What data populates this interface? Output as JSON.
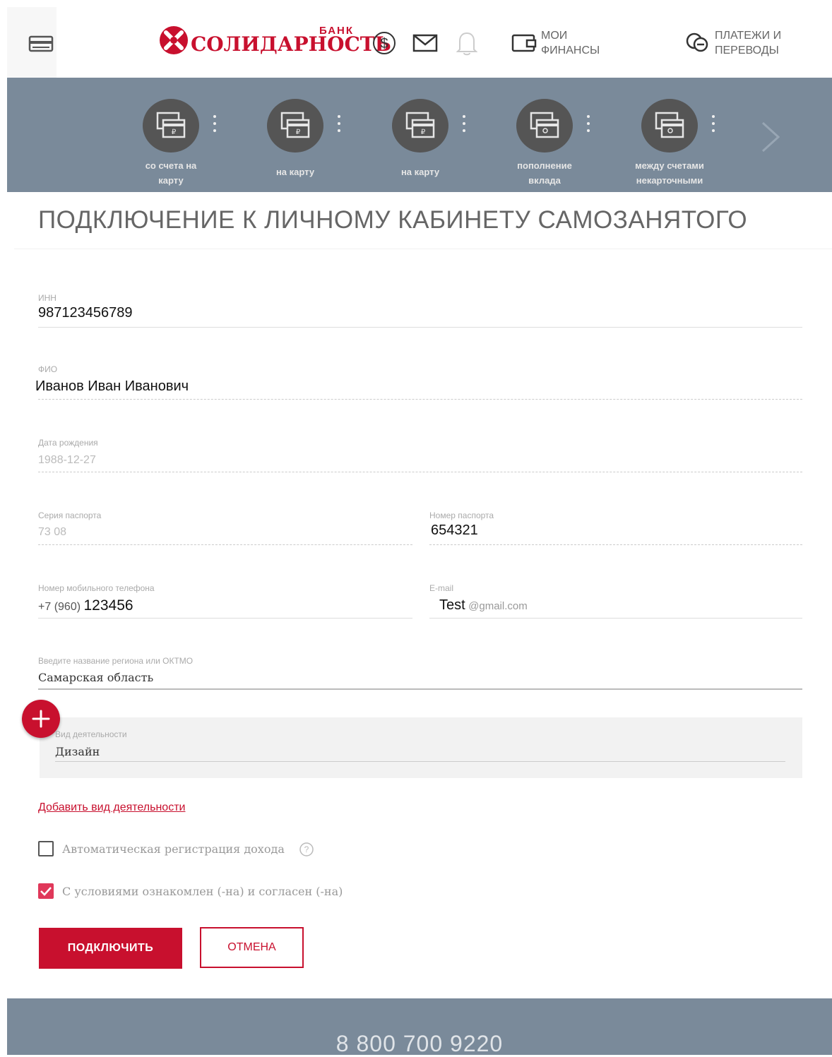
{
  "header": {
    "logo_bank": "БАНК",
    "logo_name": "СОЛИДАРНОСТЬ",
    "menu_finances": [
      "МОИ",
      "ФИНАНСЫ"
    ],
    "menu_payments": [
      "ПЛАТЕЖИ И",
      "ПЕРЕВОДЫ"
    ]
  },
  "carousel": {
    "items": [
      {
        "label": [
          "со счета на",
          "карту"
        ],
        "icon": "card-ruble-icon"
      },
      {
        "label": [
          "на карту"
        ],
        "icon": "card-ruble-icon"
      },
      {
        "label": [
          "на карту"
        ],
        "icon": "card-ruble-icon"
      },
      {
        "label": [
          "пополнение",
          "вклада"
        ],
        "icon": "card-person-icon"
      },
      {
        "label": [
          "между счетами",
          "некарточными"
        ],
        "icon": "card-person-icon"
      }
    ]
  },
  "page_title": "ПОДКЛЮЧЕНИЕ К ЛИЧНОМУ КАБИНЕТУ САМОЗАНЯТОГО",
  "form": {
    "inn": {
      "label": "ИНН",
      "value": "987123456789"
    },
    "fio": {
      "label": "ФИО",
      "value": "Иванов Иван Иванович"
    },
    "birth": {
      "label": "Дата рождения",
      "value": "1988-12-27"
    },
    "passport_series": {
      "label": "Серия паспорта",
      "value": "73 08"
    },
    "passport_number": {
      "label": "Номер паспорта",
      "value": "654321"
    },
    "phone": {
      "label": "Номер мобильного телефона",
      "prefix": "+7 (960)",
      "value": "123456"
    },
    "email": {
      "label": "E-mail",
      "value": "Test",
      "suffix": "@gmail.com"
    },
    "region": {
      "label": "Введите название региона или ОКТМО",
      "value": "Самарская область"
    },
    "activity": {
      "label": "Вид деятельности",
      "value": "Дизайн"
    },
    "add_activity": "Добавить вид деятельности",
    "auto_income": "Автоматическая регистрация дохода",
    "terms": "С условиями ознакомлен (-на) и согласен (-на)",
    "submit": "подключить",
    "cancel": "отмена"
  },
  "footer": {
    "phone": "8 800 700 9220"
  },
  "colors": {
    "brand": "#c8102e",
    "carousel_bg": "#7a8a9a"
  }
}
